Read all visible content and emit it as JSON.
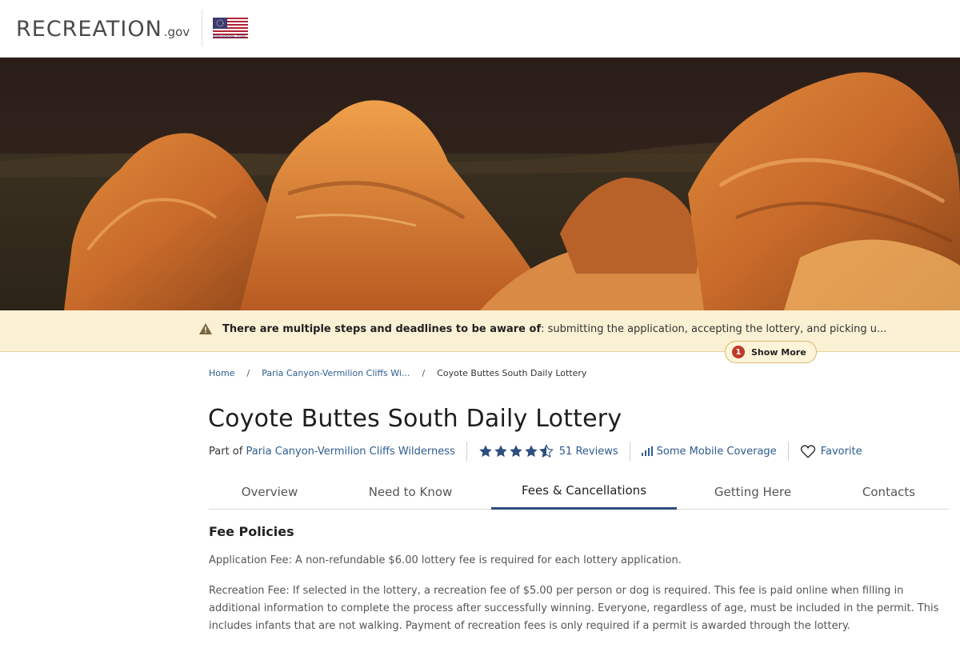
{
  "header": {
    "logo_text": "RECREATION",
    "logo_suffix": ".gov",
    "flag_caption": "Freedom 250"
  },
  "alert": {
    "strong_text": "There are multiple steps and deadlines to be aware of",
    "rest_text": ": submitting the application, accepting the lottery, and picking u...",
    "show_more": {
      "count": "1",
      "label": "Show More"
    }
  },
  "breadcrumb": {
    "items": [
      "Home",
      "Paria Canyon-Vermilion Cliffs Wi...",
      "Coyote Buttes South Daily Lottery"
    ],
    "separator": "/"
  },
  "page": {
    "title": "Coyote Buttes South Daily Lottery",
    "part_of_prefix": "Part of",
    "part_of_link": "Paria Canyon-Vermilion Cliffs Wilderness",
    "rating": 4.5,
    "reviews_label": "51 Reviews",
    "coverage_label": "Some Mobile Coverage",
    "favorite_label": "Favorite"
  },
  "tabs": [
    {
      "label": "Overview",
      "active": false
    },
    {
      "label": "Need to Know",
      "active": false
    },
    {
      "label": "Fees & Cancellations",
      "active": true
    },
    {
      "label": "Getting Here",
      "active": false
    },
    {
      "label": "Contacts",
      "active": false
    }
  ],
  "fees": {
    "title": "Fee Policies",
    "paragraphs": [
      "Application Fee: A non-refundable $6.00 lottery fee is required for each lottery application.",
      "Recreation Fee: If selected in the lottery, a recreation fee of $5.00 per person or dog is required. This fee is paid online when filling in additional information to complete the process after successfully winning. Everyone, regardless of age, must be included in the permit. This includes infants that are not walking. Payment of recreation fees is only required if a permit is awarded through the lottery."
    ]
  },
  "colors": {
    "link": "#2d5c8f",
    "alert_bg": "#faf0d4",
    "active_tab_underline": "#2d4e7e",
    "star": "#2d4e7e",
    "badge": "#c0392b"
  },
  "icons": {
    "alert": "warning-triangle-icon",
    "stars": "star-icon",
    "coverage": "signal-bars-icon",
    "favorite": "heart-icon"
  }
}
